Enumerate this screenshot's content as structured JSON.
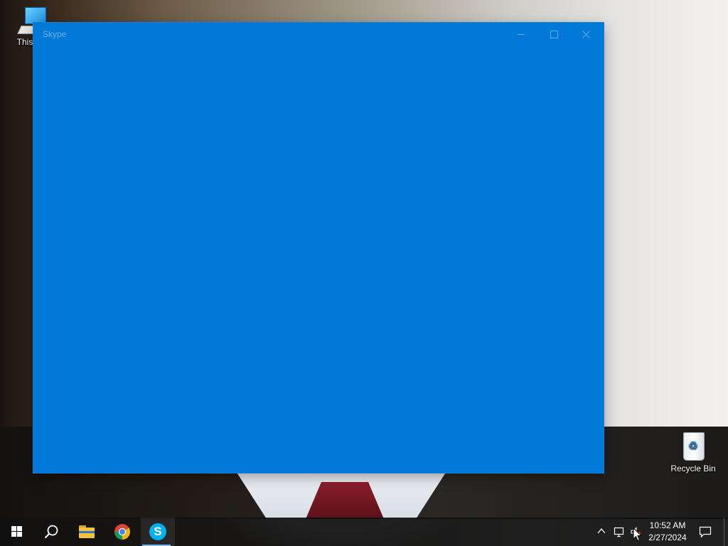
{
  "desktop": {
    "icons": [
      {
        "label": "This PC",
        "icon": "computer-icon"
      },
      {
        "label": "Recycle Bin",
        "icon": "recycle-bin-icon"
      }
    ]
  },
  "window": {
    "title": "Skype",
    "background": "#0078d7",
    "controls": {
      "minimize": "minimize-icon",
      "maximize": "maximize-icon",
      "close": "close-icon"
    }
  },
  "taskbar": {
    "background": "#101010",
    "items": [
      {
        "name": "Start",
        "icon": "windows-logo-icon"
      },
      {
        "name": "Search",
        "icon": "search-icon"
      },
      {
        "name": "File Explorer",
        "icon": "folder-icon"
      },
      {
        "name": "Google Chrome",
        "icon": "chrome-icon"
      },
      {
        "name": "Skype",
        "icon": "skype-icon",
        "active": true
      }
    ],
    "tray": {
      "icons": [
        "chevron-up-icon",
        "network-icon",
        "volume-muted-icon"
      ],
      "time": "10:52 AM",
      "date": "2/27/2024",
      "notification_icon": "notification-icon"
    }
  },
  "colors": {
    "accent": "#0078d7",
    "active_indicator": "#76b9ed"
  }
}
